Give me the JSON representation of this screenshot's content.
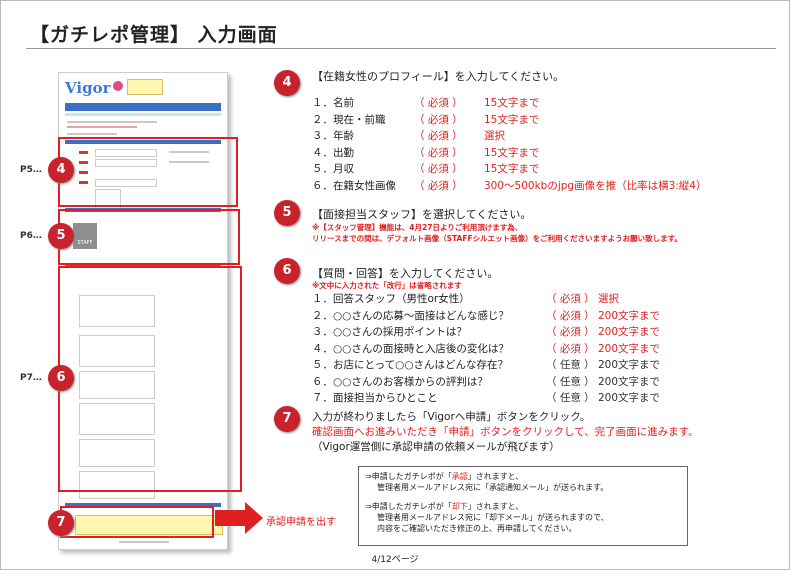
{
  "title": "【ガチレポ管理】 入力画面",
  "thumbnail": {
    "logo": "Vigor",
    "staff_label": "STAFF"
  },
  "page_labels": [
    "P5…",
    "P6…",
    "P7…"
  ],
  "badges": [
    "4",
    "5",
    "6",
    "7"
  ],
  "arrow_label": "承認申請を出す",
  "section4": {
    "heading": "【在籍女性のプロフィール】を入力してください。",
    "items": [
      {
        "label": "１．名前",
        "req": "（ 必須 ）",
        "rule": "15文字まで"
      },
      {
        "label": "２．現在・前職",
        "req": "（ 必須 ）",
        "rule": "15文字まで"
      },
      {
        "label": "３．年齢",
        "req": "（ 必須 ）",
        "rule": "選択"
      },
      {
        "label": "４．出勤",
        "req": "（ 必須 ）",
        "rule": "15文字まで"
      },
      {
        "label": "５．月収",
        "req": "（ 必須 ）",
        "rule": "15文字まで"
      },
      {
        "label": "６．在籍女性画像",
        "req": "（ 必須 ）",
        "rule": "300～500kbのjpg画像を推（比率は横3:縦4）"
      }
    ]
  },
  "section5": {
    "heading": "【面接担当スタッフ】を選択してください。",
    "note1": "※【スタッフ管理】機能は、4月27日よりご利用頂けます為、",
    "note2": "リリースまでの間は、デフォルト画像（STAFFシルエット画像）をご利用くださいますようお願い致します。"
  },
  "section6": {
    "heading": "【質問・回答】を入力してください。",
    "note": "※文中に入力された「改行」は省略されます",
    "items": [
      {
        "label": "１．回答スタッフ（男性or女性）",
        "req": "（ 必須 ）",
        "rule": "選択",
        "required": true
      },
      {
        "label": "２．○○さんの応募～面接はどんな感じ？",
        "req": "（ 必須 ）",
        "rule": "200文字まで",
        "required": true
      },
      {
        "label": "３．○○さんの採用ポイントは？",
        "req": "（ 必須 ）",
        "rule": "200文字まで",
        "required": true
      },
      {
        "label": "４．○○さんの面接時と入店後の変化は？",
        "req": "（ 必須 ）",
        "rule": "200文字まで",
        "required": true
      },
      {
        "label": "５．お店にとって○○さんはどんな存在？",
        "req": "（ 任意 ）",
        "rule": "200文字まで",
        "required": false
      },
      {
        "label": "６．○○さんのお客様からの評判は？",
        "req": "（ 任意 ）",
        "rule": "200文字まで",
        "required": false
      },
      {
        "label": "７．面接担当からひとこと",
        "req": "（ 任意 ）",
        "rule": "200文字まで",
        "required": false
      }
    ]
  },
  "section7": {
    "line1": "入力が終わりましたら「Vigorへ申請」ボタンをクリック。",
    "line2": "確認画面へお進みいただき「申請」ボタンをクリックして、完了画面に進みます。",
    "line3": "（Vigor運営側に承認申請の依頼メールが飛びます）"
  },
  "infobox": {
    "a1_pre": "⇒申請したガチレポが「",
    "a1_red": "承認",
    "a1_post": "」されますと、",
    "a2": "管理者用メールアドレス宛に「承認通知メール」が送られます。",
    "b1_pre": "⇒申請したガチレポが「",
    "b1_red": "却下",
    "b1_post": "」されますと、",
    "b2": "管理者用メールアドレス宛に「却下メール」が送られますので、",
    "b3": "内容をご確認いただき修正の上、再申請してください。"
  },
  "page_number": "4/12ページ",
  "colors": {
    "accent_red": "#e02020",
    "badge_red": "#c8232c",
    "nav_blue": "#3a6fc8"
  }
}
